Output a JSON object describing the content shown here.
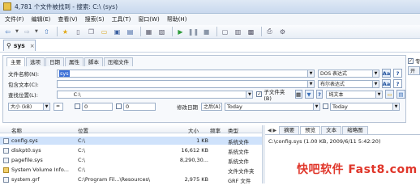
{
  "window": {
    "title": "4,781 个文件被找到 - 搜索: C:\\ (sys)"
  },
  "menu": [
    "文件(F)",
    "编辑(E)",
    "查看(V)",
    "搜索(S)",
    "工具(T)",
    "窗口(W)",
    "帮助(H)"
  ],
  "toolbar_icons": [
    "back-icon",
    "forward-icon",
    "up-icon",
    "star-icon",
    "new-icon",
    "copy-icon",
    "open-icon",
    "save-icon",
    "save-all-icon",
    "print-preview-icon",
    "export-icon",
    "play-icon",
    "pause-icon",
    "stop-icon",
    "window-icon",
    "layout-icon",
    "tile-icon",
    "print-icon",
    "settings-icon"
  ],
  "search_tab": {
    "label": "sys",
    "close": "×"
  },
  "panel": {
    "tabs": [
      "主要",
      "选项",
      "日期",
      "属性",
      "脚本",
      "压缩文件"
    ],
    "filename": {
      "label": "文件名称(N):",
      "value": "sys",
      "mode": "DOS 表达式"
    },
    "contains": {
      "label": "包含文本(C):",
      "value": "",
      "mode": "布尔表达式"
    },
    "location": {
      "label": "查找位置(L):",
      "value": "C:\\",
      "subfolders": "子文件夹(B)",
      "type": "纯文本"
    },
    "size": {
      "label": "大小 (kB)",
      "op": "=",
      "min": "0",
      "max": "0"
    },
    "date": {
      "label": "修改日期",
      "op": "之后(A)",
      "from": "Today",
      "to": "Today"
    }
  },
  "sidebar": {
    "check_label": "专",
    "button_label": "开"
  },
  "results": {
    "columns": [
      "名称",
      "位置",
      "大小",
      "频率",
      "类型"
    ],
    "rows": [
      {
        "name": "config.sys",
        "location": "C:\\",
        "size": "1 KB",
        "freq": "",
        "type": "系统文件",
        "folder": false
      },
      {
        "name": "diskpt0.sys",
        "location": "C:\\",
        "size": "16,612 KB",
        "freq": "",
        "type": "系统文件",
        "folder": false
      },
      {
        "name": "pagefile.sys",
        "location": "C:\\",
        "size": "8,290,30...",
        "freq": "",
        "type": "系统文件",
        "folder": false
      },
      {
        "name": "System Volume Info...",
        "location": "C:\\",
        "size": "",
        "freq": "",
        "type": "文件文件夹",
        "folder": true
      },
      {
        "name": "system.grf",
        "location": "C:\\Program Fil...\\Resources\\",
        "size": "2,975 KB",
        "freq": "",
        "type": "GRF 文件",
        "folder": false
      }
    ]
  },
  "preview": {
    "nav": "◀ ▶",
    "tabs": [
      "摘要",
      "预览",
      "文本",
      "缩略图"
    ],
    "text": "C:\\config.sys  (1.00 KB, 2009/6/11 5:42:20)"
  },
  "watermark": "快吧软件 Fast8.com"
}
